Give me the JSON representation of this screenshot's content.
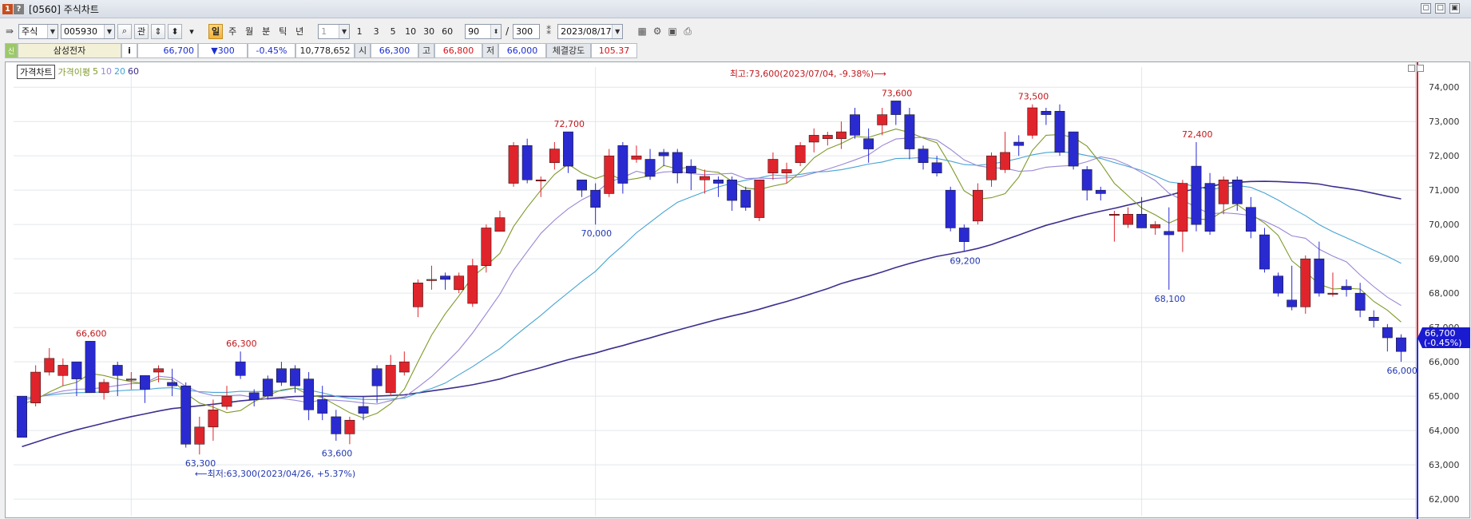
{
  "window": {
    "title": "[0560] 주식차트",
    "badge1": "1",
    "badge2": "?"
  },
  "toolbar": {
    "market": "주식",
    "code": "005930",
    "icon_btn": "관",
    "periods": [
      "일",
      "주",
      "월",
      "분",
      "틱",
      "년"
    ],
    "active_period": "일",
    "unit_value": "1",
    "unit_presets": [
      "1",
      "3",
      "5",
      "10",
      "30",
      "60"
    ],
    "count_value": "90",
    "count_sep": "/",
    "count_total": "300",
    "date": "2023/08/17"
  },
  "quote": {
    "name": "삼성전자",
    "info_btn": "i",
    "price": "66,700",
    "change": "▼300",
    "change_pct": "-0.45%",
    "volume": "10,778,652",
    "open_label": "시",
    "open": "66,300",
    "high_label": "고",
    "high": "66,800",
    "low_label": "저",
    "low": "66,000",
    "strength_label": "체결강도",
    "strength": "105.37"
  },
  "legend": {
    "chart_name": "가격차트",
    "ma_label": "가격이평",
    "ma_periods": [
      "5",
      "10",
      "20",
      "60"
    ]
  },
  "colors": {
    "up": "#e0242b",
    "down": "#2a2ad1",
    "ma5": "#7f9a2a",
    "ma10": "#9b86d6",
    "ma20": "#47a3d3",
    "ma60": "#3c2f8f",
    "grid": "#e3e6ea"
  },
  "chart_data": {
    "type": "candlestick",
    "y_ticks": [
      "74,000",
      "73,000",
      "72,000",
      "71,000",
      "70,000",
      "69,000",
      "68,000",
      "67,000",
      "66,000",
      "65,000",
      "64,000",
      "63,000",
      "62,000"
    ],
    "ylim": [
      61700,
      74400
    ],
    "current_price_tag": "66,700",
    "current_pct_tag": "(-0.45%)",
    "annotations": {
      "max": "최고:73,600(2023/07/04, -9.38%)⟶",
      "min": "⟵최저:63,300(2023/04/26, +5.37%)",
      "peaks": [
        "66,600",
        "66,300",
        "72,700",
        "73,600",
        "73,500",
        "72,400"
      ],
      "troughs": [
        "63,300",
        "63,600",
        "70,000",
        "69,200",
        "68,100",
        "66,000"
      ]
    },
    "candles": [
      [
        65000,
        63800,
        65000,
        63800
      ],
      [
        64800,
        65700,
        65900,
        64700
      ],
      [
        65700,
        66100,
        66400,
        65600
      ],
      [
        65600,
        65900,
        66100,
        65300
      ],
      [
        66000,
        65500,
        66000,
        65000
      ],
      [
        66600,
        65100,
        66600,
        65100
      ],
      [
        65100,
        65400,
        65500,
        64900
      ],
      [
        65900,
        65600,
        66000,
        65000
      ],
      [
        65500,
        65500,
        65700,
        65200
      ],
      [
        65600,
        65200,
        65600,
        64800
      ],
      [
        65700,
        65800,
        65900,
        65400
      ],
      [
        65400,
        65300,
        65800,
        65000
      ],
      [
        65300,
        63600,
        65400,
        63500
      ],
      [
        63600,
        64100,
        64400,
        63300
      ],
      [
        64100,
        64600,
        64900,
        63700
      ],
      [
        64700,
        65000,
        65300,
        64600
      ],
      [
        66000,
        65600,
        66300,
        65500
      ],
      [
        65100,
        64900,
        65200,
        64700
      ],
      [
        65500,
        65000,
        65600,
        64900
      ],
      [
        65800,
        65400,
        66000,
        65300
      ],
      [
        65800,
        65300,
        65900,
        65100
      ],
      [
        65500,
        64600,
        65700,
        64300
      ],
      [
        64900,
        64500,
        65300,
        64300
      ],
      [
        64400,
        63900,
        64600,
        63700
      ],
      [
        63900,
        64300,
        64400,
        63600
      ],
      [
        64700,
        64500,
        65000,
        64300
      ],
      [
        65800,
        65300,
        65900,
        64800
      ],
      [
        65100,
        65900,
        66200,
        65000
      ],
      [
        65700,
        66000,
        66300,
        65600
      ],
      [
        67600,
        68300,
        68400,
        67300
      ],
      [
        68400,
        68400,
        68800,
        68100
      ],
      [
        68500,
        68400,
        68600,
        68100
      ],
      [
        68100,
        68500,
        68600,
        68000
      ],
      [
        67700,
        68800,
        69000,
        67600
      ],
      [
        68800,
        69900,
        70000,
        68600
      ],
      [
        69800,
        70200,
        70400,
        69800
      ],
      [
        71200,
        72300,
        72400,
        71100
      ],
      [
        72300,
        71300,
        72500,
        71200
      ],
      [
        71300,
        71300,
        71400,
        70800
      ],
      [
        71800,
        72200,
        72400,
        71600
      ],
      [
        72700,
        71700,
        72700,
        71500
      ],
      [
        71300,
        71000,
        71300,
        70800
      ],
      [
        71000,
        70500,
        71200,
        70000
      ],
      [
        70900,
        72000,
        72200,
        70800
      ],
      [
        72300,
        71200,
        72400,
        70900
      ],
      [
        71900,
        72000,
        72300,
        71800
      ],
      [
        71900,
        71400,
        72200,
        71300
      ],
      [
        72100,
        72000,
        72200,
        71700
      ],
      [
        72100,
        71500,
        72200,
        71200
      ],
      [
        71700,
        71500,
        71900,
        71000
      ],
      [
        71300,
        71400,
        71600,
        70900
      ],
      [
        71300,
        71200,
        71400,
        70800
      ],
      [
        71300,
        70700,
        71400,
        70400
      ],
      [
        71000,
        70500,
        71100,
        70400
      ],
      [
        70200,
        71300,
        71300,
        70100
      ],
      [
        71500,
        71900,
        72100,
        71300
      ],
      [
        71500,
        71600,
        71800,
        71200
      ],
      [
        71800,
        72300,
        72400,
        71700
      ],
      [
        72400,
        72600,
        72800,
        72100
      ],
      [
        72500,
        72600,
        72700,
        72300
      ],
      [
        72500,
        72700,
        73000,
        72200
      ],
      [
        73200,
        72600,
        73400,
        72500
      ],
      [
        72500,
        72200,
        72800,
        71800
      ],
      [
        72900,
        73200,
        73400,
        72600
      ],
      [
        73600,
        73200,
        73600,
        72900
      ],
      [
        73200,
        72200,
        73400,
        71900
      ],
      [
        72200,
        71800,
        72300,
        71600
      ],
      [
        71800,
        71500,
        72000,
        71400
      ],
      [
        71000,
        69900,
        71100,
        69800
      ],
      [
        69900,
        69500,
        70000,
        69200
      ],
      [
        70100,
        71000,
        71200,
        70000
      ],
      [
        71300,
        72000,
        72100,
        71100
      ],
      [
        71600,
        72100,
        72700,
        71500
      ],
      [
        72400,
        72300,
        72600,
        72000
      ],
      [
        72600,
        73400,
        73500,
        72500
      ],
      [
        73300,
        73200,
        73400,
        72900
      ],
      [
        73300,
        72100,
        73500,
        72000
      ],
      [
        72700,
        71700,
        72700,
        71600
      ],
      [
        71600,
        71000,
        71700,
        70700
      ],
      [
        71000,
        70900,
        71100,
        70700
      ],
      [
        70300,
        70300,
        70400,
        69500
      ],
      [
        70000,
        70300,
        70500,
        69900
      ],
      [
        70300,
        69900,
        70800,
        69900
      ],
      [
        69900,
        70000,
        70100,
        69700
      ],
      [
        69800,
        69700,
        70500,
        68100
      ],
      [
        69800,
        71200,
        71300,
        69200
      ],
      [
        71700,
        70000,
        72400,
        69800
      ],
      [
        71200,
        69800,
        71500,
        69700
      ],
      [
        70600,
        71300,
        71400,
        70300
      ],
      [
        71300,
        70600,
        71400,
        70400
      ],
      [
        70500,
        69800,
        70800,
        69600
      ],
      [
        69700,
        68700,
        69900,
        68600
      ],
      [
        68500,
        68000,
        68600,
        67900
      ],
      [
        67800,
        67600,
        68800,
        67500
      ],
      [
        67600,
        69000,
        69100,
        67400
      ],
      [
        69000,
        68000,
        69500,
        67900
      ],
      [
        68000,
        68000,
        68600,
        67900
      ],
      [
        68200,
        68100,
        68400,
        67900
      ],
      [
        68000,
        67500,
        68300,
        67300
      ],
      [
        67300,
        67200,
        67500,
        67000
      ],
      [
        67000,
        66700,
        67100,
        66300
      ],
      [
        66700,
        66300,
        66800,
        66000
      ]
    ]
  }
}
